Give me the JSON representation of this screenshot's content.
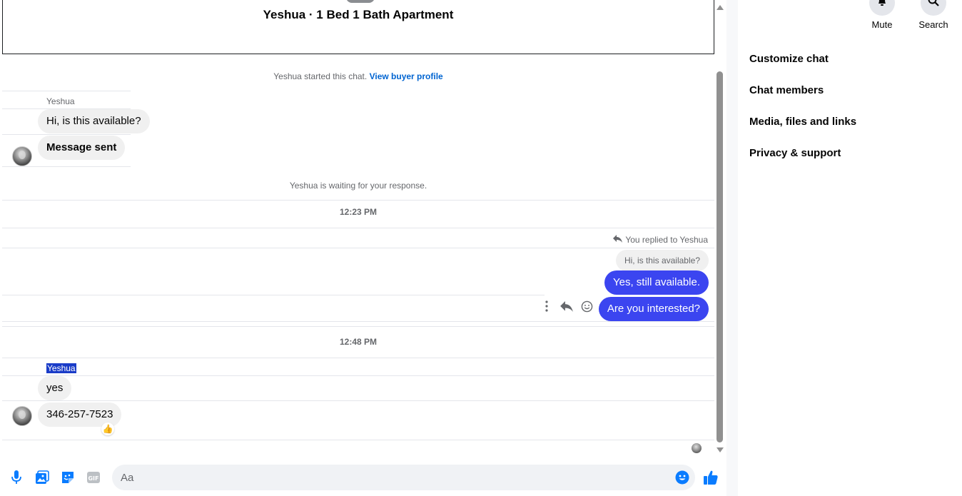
{
  "header": {
    "title": "Yeshua · 1 Bed 1 Bath Apartment"
  },
  "chat_start": {
    "text": "Yeshua started this chat.",
    "link": "View buyer profile"
  },
  "group1": {
    "sender": "Yeshua",
    "messages": [
      "Hi, is this available?",
      "Message sent"
    ]
  },
  "waiting": "Yeshua is waiting for your response.",
  "time1": "12:23 PM",
  "reply": {
    "label": "You replied to Yeshua",
    "quoted": "Hi, is this available?",
    "messages": [
      "Yes, still available.",
      "Are you interested?"
    ]
  },
  "time2": "12:48 PM",
  "group2": {
    "sender": "Yeshua",
    "messages": [
      "yes",
      "346-257-7523"
    ],
    "reaction": "👍"
  },
  "composer": {
    "placeholder": "Aa"
  },
  "side": {
    "buttons": [
      {
        "label": "Mute",
        "icon": "bell-icon"
      },
      {
        "label": "Search",
        "icon": "search-icon"
      }
    ],
    "menu": [
      "Customize chat",
      "Chat members",
      "Media, files and links",
      "Privacy & support"
    ]
  },
  "colors": {
    "accent": "#3b45f0",
    "link": "#0064d1",
    "icon_blue": "#0a7cff"
  }
}
